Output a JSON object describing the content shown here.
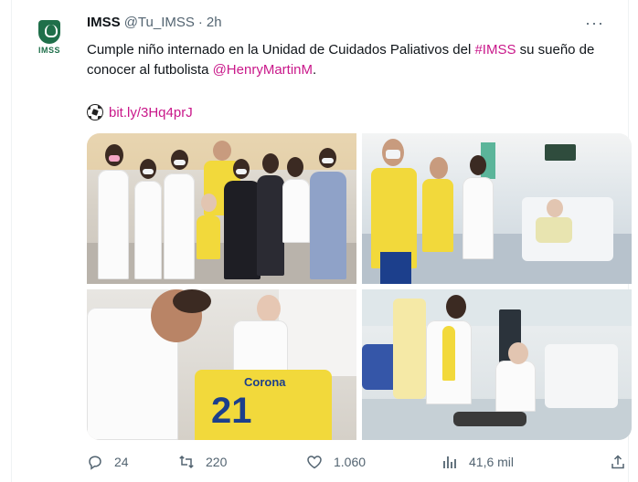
{
  "tweet": {
    "name": "IMSS",
    "handle": "@Tu_IMSS",
    "dot": "·",
    "time": "2h",
    "avatar_label": "IMSS",
    "more_label": "···",
    "text_part1": "Cumple niño internado en la Unidad de Cuidados Paliativos del ",
    "hashtag": "#IMSS",
    "text_part2": " su sueño de conocer al futbolista ",
    "mention": "@HenryMartinM",
    "text_part3": ".",
    "link": "bit.ly/3Hq4prJ",
    "photos": [
      {
        "id": "photo-1",
        "alt": ""
      },
      {
        "id": "photo-2",
        "alt": ""
      },
      {
        "id": "photo-3",
        "alt": ""
      },
      {
        "id": "photo-4",
        "alt": ""
      }
    ],
    "jersey_text": "Corona",
    "jersey_number": "21",
    "counts": {
      "replies": "24",
      "retweets": "220",
      "likes": "1.060",
      "views": "41,6 mil"
    }
  },
  "colors": {
    "accent": "#c9188a",
    "muted": "#536471",
    "text": "#0f1419",
    "imss_green": "#1f6f4a"
  },
  "icons": [
    "imss-logo",
    "more-icon",
    "soccer-ball-icon",
    "reply-icon",
    "retweet-icon",
    "like-icon",
    "views-icon",
    "share-icon"
  ]
}
